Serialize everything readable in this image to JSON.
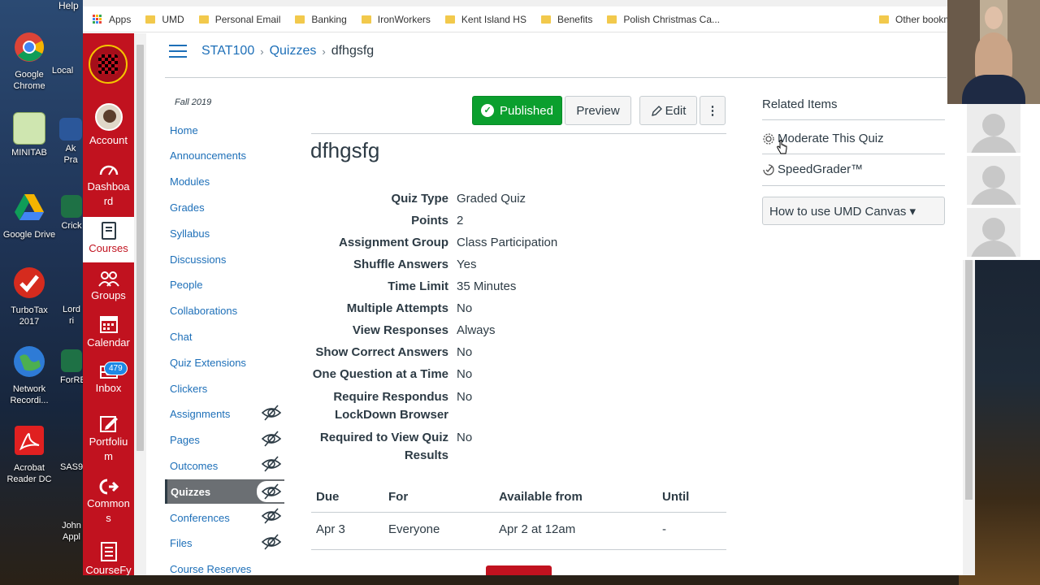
{
  "desktop": {
    "help_label": "Help",
    "icons": [
      {
        "label": "Google Chrome"
      },
      {
        "label": "Local"
      },
      {
        "label": "MINITAB"
      },
      {
        "label": "Ak Pra"
      },
      {
        "label": "Google Drive"
      },
      {
        "label": "Crick"
      },
      {
        "label": "TurboTax 2017"
      },
      {
        "label": "Lord ri"
      },
      {
        "label": "Network Recordi..."
      },
      {
        "label": "ForRE"
      },
      {
        "label": "Acrobat Reader DC"
      },
      {
        "label": "SAS9"
      },
      {
        "label": "John Appl"
      }
    ]
  },
  "bookmarks": {
    "items": [
      "Apps",
      "UMD",
      "Personal Email",
      "Banking",
      "IronWorkers",
      "Kent Island HS",
      "Benefits",
      "Polish Christmas Ca..."
    ],
    "other": "Other bookm"
  },
  "global_nav": {
    "account": "Account",
    "dashboard": "Dashboa rd",
    "courses": "Courses",
    "groups": "Groups",
    "calendar": "Calendar",
    "inbox": "Inbox",
    "inbox_count": "479",
    "portfolium": "Portfoliu m",
    "commons": "Common s",
    "coursefy": "CourseFy"
  },
  "breadcrumb": {
    "course": "STAT100",
    "section": "Quizzes",
    "current": "dfhgsfg"
  },
  "course_nav": {
    "term": "Fall 2019",
    "items": [
      {
        "label": "Home"
      },
      {
        "label": "Announcements"
      },
      {
        "label": "Modules"
      },
      {
        "label": "Grades"
      },
      {
        "label": "Syllabus"
      },
      {
        "label": "Discussions"
      },
      {
        "label": "People"
      },
      {
        "label": "Collaborations"
      },
      {
        "label": "Chat"
      },
      {
        "label": "Quiz Extensions"
      },
      {
        "label": "Clickers"
      },
      {
        "label": "Assignments"
      },
      {
        "label": "Pages"
      },
      {
        "label": "Outcomes"
      },
      {
        "label": "Quizzes"
      },
      {
        "label": "Conferences"
      },
      {
        "label": "Files"
      },
      {
        "label": "Course Reserves"
      }
    ]
  },
  "toolbar": {
    "published": "Published",
    "preview": "Preview",
    "edit": "Edit",
    "more": "⋮"
  },
  "quiz": {
    "title": "dfhgsfg",
    "details": [
      {
        "label": "Quiz Type",
        "value": "Graded Quiz"
      },
      {
        "label": "Points",
        "value": "2"
      },
      {
        "label": "Assignment Group",
        "value": "Class Participation"
      },
      {
        "label": "Shuffle Answers",
        "value": "Yes"
      },
      {
        "label": "Time Limit",
        "value": "35 Minutes"
      },
      {
        "label": "Multiple Attempts",
        "value": "No"
      },
      {
        "label": "View Responses",
        "value": "Always"
      },
      {
        "label": "Show Correct Answers",
        "value": "No"
      },
      {
        "label": "One Question at a Time",
        "value": "No"
      },
      {
        "label": "Require Respondus",
        "label2": "LockDown Browser",
        "value": "No"
      },
      {
        "label": "Required to View Quiz",
        "label2": "Results",
        "value": "No"
      }
    ]
  },
  "due_table": {
    "headers": [
      "Due",
      "For",
      "Available from",
      "Until"
    ],
    "rows": [
      [
        "Apr 3",
        "Everyone",
        "Apr 2 at 12am",
        "-"
      ]
    ]
  },
  "related": {
    "title": "Related Items",
    "moderate": "Moderate This Quiz",
    "speedgrader": "SpeedGrader™",
    "howto": "How to use UMD Canvas ▾"
  },
  "colors": {
    "canvas_red": "#c1121f",
    "link_blue": "#1d6fb8",
    "published_green": "#0b9f2e"
  }
}
